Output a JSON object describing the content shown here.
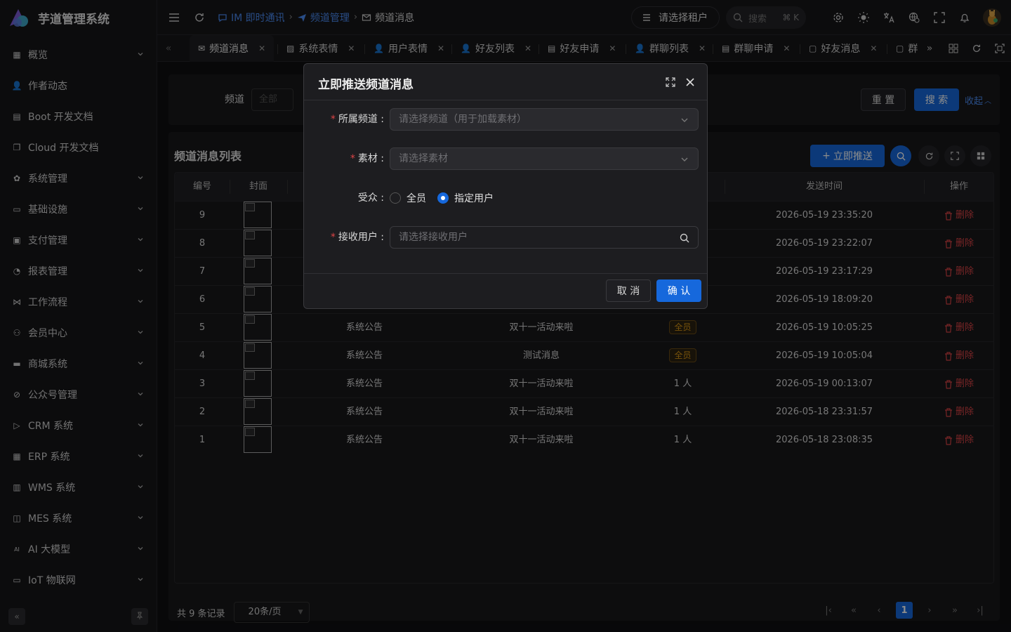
{
  "app": {
    "title": "芋道管理系统"
  },
  "sidebar": {
    "items": [
      {
        "label": "概览",
        "icon": "dashboard-icon",
        "expandable": true
      },
      {
        "label": "作者动态",
        "icon": "user-icon",
        "expandable": false
      },
      {
        "label": "Boot 开发文档",
        "icon": "document-icon",
        "expandable": false
      },
      {
        "label": "Cloud 开发文档",
        "icon": "copy-icon",
        "expandable": false
      },
      {
        "label": "系统管理",
        "icon": "gear-icon",
        "expandable": true
      },
      {
        "label": "基础设施",
        "icon": "monitor-icon",
        "expandable": true
      },
      {
        "label": "支付管理",
        "icon": "payment-icon",
        "expandable": true
      },
      {
        "label": "报表管理",
        "icon": "chart-icon",
        "expandable": true
      },
      {
        "label": "工作流程",
        "icon": "workflow-icon",
        "expandable": true
      },
      {
        "label": "会员中心",
        "icon": "members-icon",
        "expandable": true
      },
      {
        "label": "商城系统",
        "icon": "shop-icon",
        "expandable": true
      },
      {
        "label": "公众号管理",
        "icon": "compass-icon",
        "expandable": true
      },
      {
        "label": "CRM 系统",
        "icon": "crm-icon",
        "expandable": true
      },
      {
        "label": "ERP 系统",
        "icon": "erp-icon",
        "expandable": true
      },
      {
        "label": "WMS 系统",
        "icon": "warehouse-icon",
        "expandable": true
      },
      {
        "label": "MES 系统",
        "icon": "chip-icon",
        "expandable": true
      },
      {
        "label": "AI 大模型",
        "icon": "ai-icon",
        "expandable": true
      },
      {
        "label": "IoT 物联网",
        "icon": "iot-icon",
        "expandable": true
      }
    ]
  },
  "header": {
    "breadcrumbs": [
      {
        "label": "IM 即时通讯",
        "icon": "chat-icon"
      },
      {
        "label": "频道管理",
        "icon": "send-icon"
      },
      {
        "label": "频道消息",
        "icon": "mail-icon"
      }
    ],
    "tenant_label": "请选择租户",
    "search_placeholder": "搜索",
    "search_shortcut": "⌘ K"
  },
  "tabs": [
    {
      "label": "频道消息",
      "icon": "mail-icon",
      "active": true
    },
    {
      "label": "系统表情",
      "icon": "image-icon"
    },
    {
      "label": "用户表情",
      "icon": "user-icon"
    },
    {
      "label": "好友列表",
      "icon": "user-icon"
    },
    {
      "label": "好友申请",
      "icon": "document-icon"
    },
    {
      "label": "群聊列表",
      "icon": "user-icon"
    },
    {
      "label": "群聊申请",
      "icon": "document-icon"
    },
    {
      "label": "好友消息",
      "icon": "chat-icon"
    },
    {
      "label": "群",
      "icon": "chat-icon"
    }
  ],
  "filter": {
    "channel_label": "频道",
    "channel_value": "全部",
    "reset_label": "重 置",
    "search_label": "搜 索",
    "collapse_label": "收起"
  },
  "list": {
    "title": "频道消息列表",
    "push_label": "立即推送",
    "columns": {
      "id": "编号",
      "cover": "封面",
      "send_time": "发送时间",
      "actions": "操作"
    },
    "delete_label": "删除",
    "rows": [
      {
        "id": "9",
        "channel": "",
        "material": "",
        "audience": "",
        "audience_tag": false,
        "send_time": "2026-05-19 23:35:20"
      },
      {
        "id": "8",
        "channel": "",
        "material": "",
        "audience": "",
        "audience_tag": false,
        "send_time": "2026-05-19 23:22:07"
      },
      {
        "id": "7",
        "channel": "",
        "material": "",
        "audience": "",
        "audience_tag": false,
        "send_time": "2026-05-19 23:17:29"
      },
      {
        "id": "6",
        "channel": "",
        "material": "",
        "audience": "",
        "audience_tag": false,
        "send_time": "2026-05-19 18:09:20"
      },
      {
        "id": "5",
        "channel": "系统公告",
        "material": "双十一活动来啦",
        "audience": "全员",
        "audience_tag": true,
        "send_time": "2026-05-19 10:05:25"
      },
      {
        "id": "4",
        "channel": "系统公告",
        "material": "测试消息",
        "audience": "全员",
        "audience_tag": true,
        "send_time": "2026-05-19 10:05:04"
      },
      {
        "id": "3",
        "channel": "系统公告",
        "material": "双十一活动来啦",
        "audience": "1 人",
        "audience_tag": false,
        "send_time": "2026-05-19 00:13:07"
      },
      {
        "id": "2",
        "channel": "系统公告",
        "material": "双十一活动来啦",
        "audience": "1 人",
        "audience_tag": false,
        "send_time": "2026-05-18 23:31:57"
      },
      {
        "id": "1",
        "channel": "系统公告",
        "material": "双十一活动来啦",
        "audience": "1 人",
        "audience_tag": false,
        "send_time": "2026-05-18 23:08:35"
      }
    ]
  },
  "pagination": {
    "total_text": "共 9 条记录",
    "page_size": "20条/页",
    "current_page": "1"
  },
  "modal": {
    "title": "立即推送频道消息",
    "fields": {
      "channel_label": "所属频道",
      "channel_placeholder": "请选择频道（用于加载素材）",
      "material_label": "素材",
      "material_placeholder": "请选择素材",
      "audience_label": "受众",
      "audience_options": [
        "全员",
        "指定用户"
      ],
      "audience_selected": "指定用户",
      "receiver_label": "接收用户",
      "receiver_placeholder": "请选择接收用户"
    },
    "cancel_label": "取 消",
    "confirm_label": "确 认"
  },
  "colors": {
    "primary": "#1668dc",
    "danger": "#dc4446",
    "warning": "#d89614",
    "background": "#101014"
  }
}
